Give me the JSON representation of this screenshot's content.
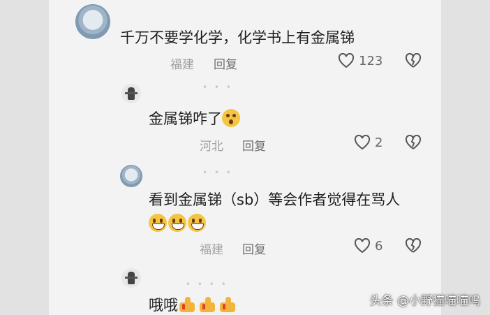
{
  "comments": [
    {
      "text": "千万不要学化学，化学书上有金属锑",
      "location": "福建",
      "reply_label": "回复",
      "like_count": "123"
    },
    {
      "text": "金属锑咋了",
      "location": "河北",
      "reply_label": "回复",
      "like_count": "2"
    },
    {
      "text": "看到金属锑（sb）等会作者觉得在骂人",
      "location": "福建",
      "reply_label": "回复",
      "like_count": "6"
    },
    {
      "text": "哦哦"
    }
  ],
  "watermark": {
    "text": "头条 @小野猫喵喵呜"
  },
  "colors": {
    "background": "#f3f3f3",
    "meta_text": "#a0a0a0",
    "reply_text": "#6f6f6f"
  },
  "icons": [
    "heart-icon",
    "broken-heart-icon",
    "grinning-emoji",
    "surprised-emoji",
    "thumbs-up-emoji"
  ]
}
